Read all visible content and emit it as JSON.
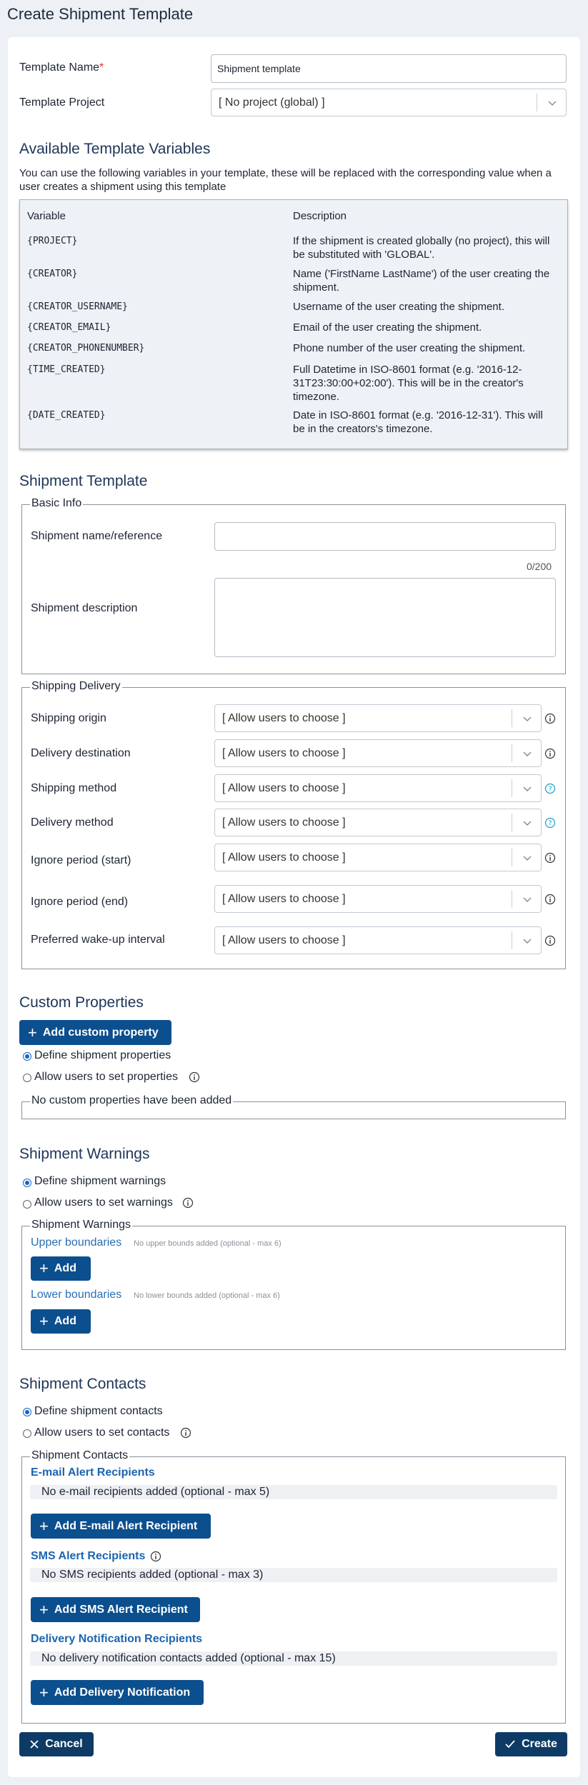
{
  "page": {
    "title": "Create Shipment Template"
  },
  "template": {
    "name_label": "Template Name",
    "required_mark": "*",
    "name_value": "Shipment template",
    "project_label": "Template Project",
    "project_value": "[ No project (global) ]"
  },
  "variables": {
    "heading": "Available Template Variables",
    "intro": "You can use the following variables in your template, these will be replaced with the corresponding value when a user creates a shipment using this template",
    "col_variable": "Variable",
    "col_description": "Description",
    "rows": [
      {
        "name": "{PROJECT}",
        "desc": "If the shipment is created globally (no project), this will be substituted with 'GLOBAL'."
      },
      {
        "name": "{CREATOR}",
        "desc": "Name ('FirstName LastName') of the user creating the shipment."
      },
      {
        "name": "{CREATOR_USERNAME}",
        "desc": "Username of the user creating the shipment."
      },
      {
        "name": "{CREATOR_EMAIL}",
        "desc": "Email of the user creating the shipment."
      },
      {
        "name": "{CREATOR_PHONENUMBER}",
        "desc": "Phone number of the user creating the shipment."
      },
      {
        "name": "{TIME_CREATED}",
        "desc": "Full Datetime in ISO-8601 format (e.g. '2016-12-31T23:30:00+02:00'). This will be in the creator's timezone."
      },
      {
        "name": "{DATE_CREATED}",
        "desc": "Date in ISO-8601 format (e.g. '2016-12-31'). This will be in the creators's timezone."
      }
    ]
  },
  "shipment_template": {
    "heading": "Shipment Template",
    "basic_info": {
      "legend": "Basic Info",
      "name_label": "Shipment name/reference",
      "name_value": "",
      "counter": "0/200",
      "desc_label": "Shipment description",
      "desc_value": ""
    },
    "delivery": {
      "legend": "Shipping Delivery",
      "fields": [
        {
          "label": "Shipping origin",
          "value": "[ Allow users to choose ]",
          "icon": "info-icon"
        },
        {
          "label": "Delivery destination",
          "value": "[ Allow users to choose ]",
          "icon": "info-icon"
        },
        {
          "label": "Shipping method",
          "value": "[ Allow users to choose ]",
          "icon": "help-icon"
        },
        {
          "label": "Delivery method",
          "value": "[ Allow users to choose ]",
          "icon": "help-icon"
        },
        {
          "label": "Ignore period (start)",
          "value": "[ Allow users to choose ]",
          "icon": "info-icon"
        },
        {
          "label": "Ignore period (end)",
          "value": "[ Allow users to choose ]",
          "icon": "info-icon"
        },
        {
          "label": "Preferred wake-up interval",
          "value": "[ Allow users to choose ]",
          "icon": "info-icon"
        }
      ]
    }
  },
  "custom_properties": {
    "heading": "Custom Properties",
    "add_button": "Add custom property",
    "radio_define": "Define shipment properties",
    "radio_allow": "Allow users to set properties",
    "empty_legend": "No custom properties have been added"
  },
  "warnings": {
    "heading": "Shipment Warnings",
    "radio_define": "Define shipment warnings",
    "radio_allow": "Allow users to set warnings",
    "legend": "Shipment Warnings",
    "upper_label": "Upper boundaries",
    "upper_hint": "No upper bounds added (optional - max 6)",
    "lower_label": "Lower boundaries",
    "lower_hint": "No lower bounds added (optional - max 6)",
    "add_label": "Add"
  },
  "contacts": {
    "heading": "Shipment Contacts",
    "radio_define": "Define shipment contacts",
    "radio_allow": "Allow users to set contacts",
    "legend": "Shipment Contacts",
    "email_heading": "E-mail Alert Recipients",
    "email_empty": "No e-mail recipients added (optional - max 5)",
    "email_button": "Add E-mail Alert Recipient",
    "sms_heading": "SMS Alert Recipients",
    "sms_empty": "No SMS recipients added (optional - max 3)",
    "sms_button": "Add SMS Alert Recipient",
    "delivery_heading": "Delivery Notification Recipients",
    "delivery_empty": "No delivery notification contacts added (optional - max 15)",
    "delivery_button": "Add Delivery Notification"
  },
  "footer": {
    "cancel": "Cancel",
    "create": "Create"
  },
  "colors": {
    "primary": "#0b4f8f",
    "footer": "#0d3b66",
    "link": "#2a6fb5",
    "background": "#edf1f5"
  }
}
